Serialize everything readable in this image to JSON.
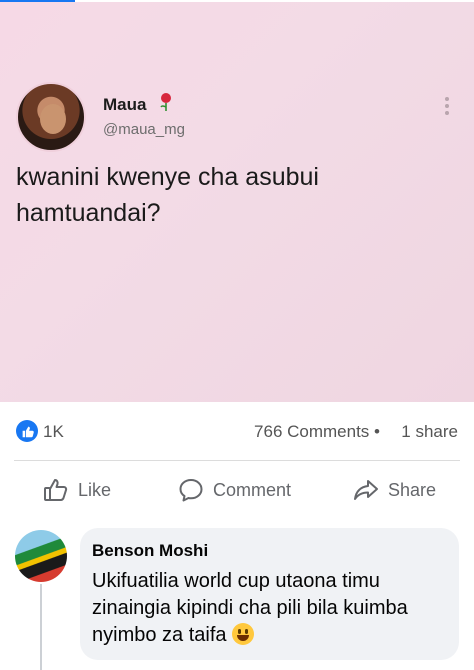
{
  "post": {
    "author_name": "Maua",
    "author_handle": "@maua_mg",
    "text": "kwanini kwenye cha asubui hamtuandai?"
  },
  "stats": {
    "likes": "1K",
    "comments": "766 Comments",
    "separator": "•",
    "shares": "1 share"
  },
  "actions": {
    "like": "Like",
    "comment": "Comment",
    "share": "Share"
  },
  "comment": {
    "author": "Benson Moshi",
    "text": "Ukifuatilia world cup utaona timu zinaingia kipindi cha pili bila kuimba  nyimbo za taifa",
    "emoji": "grinning-face-emoji"
  },
  "colors": {
    "accent": "#1877f2",
    "post_background": "#f3dbe6",
    "comment_bubble": "#f0f2f5",
    "muted_text": "#65676b"
  },
  "icons": [
    "rose-icon",
    "more-options-icon",
    "like-badge-icon",
    "thumbs-up-icon",
    "comment-icon",
    "share-icon"
  ]
}
